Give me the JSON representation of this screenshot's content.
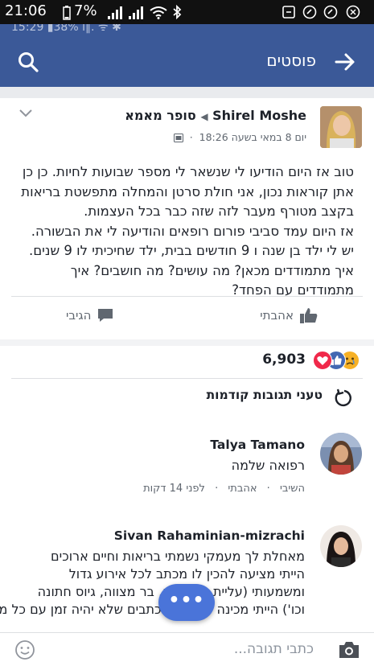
{
  "status_bar": {
    "time": "21:06",
    "battery": "7%",
    "icons": [
      "battery-icon",
      "signal-icon",
      "signal-icon",
      "wifi-icon",
      "bluetooth-icon",
      "notification-icon",
      "app-icon",
      "app-icon",
      "app-icon"
    ]
  },
  "ghost_status": {
    "text": "15:29 ▮38% ⅰ‖. ᯤ ✱"
  },
  "navbar": {
    "title": "פוסטים",
    "background": "#3b5998",
    "icons": [
      "back-arrow-icon",
      "search-icon"
    ]
  },
  "post": {
    "author": "Shirel Moshe",
    "separator": "◀",
    "group": "סופר מאמא",
    "timestamp": "יום 8 במאי בשעה 18:26",
    "body": [
      "טוב אז היום הודיעו לי שנשאר לי מספר שבועות לחיות. כן כן אתן קוראות נכון, אני חולת סרטן והמחלה מתפשטת בריאות בקצב מטורף מעבר לזה שזה כבר בכל העצמות.",
      "אז היום עמד סביבי פורום רופאים והודיעה לי את הבשורה.",
      "יש לי ילד בן שנה ו 9 חודשים בבית, ילד שחיכיתי לו 9 שנים. איך מתמודדים מכאן? מה עושים? מה חושבים? איך מתמודדים עם הפחד?"
    ],
    "like_label": "אהבתי",
    "comment_label": "הגיבי",
    "reactions_count": "6,903"
  },
  "prev_comments_label": "טעני תגובות קודמות",
  "comments": [
    {
      "name": "Talya Tamano",
      "text": "רפואה שלמה",
      "reply": "השיבי",
      "like": "אהבתי",
      "time": "לפני 14 דקות"
    },
    {
      "name": "Sivan Rahaminian-mizrachi",
      "lines": [
        "מאחלת לך מעמקי נשמתי בריאות וחיים ארוכים",
        "הייתי מציעה להכין לו מכתב לכל אירוע גדול",
        "ומשמעותי (עליית לכיתה א, בר מצווה, גיוס חתונה",
        "וכו') הייתי מכינה לו שלל מכתבים שלא יהיה זמן עם כל מיני דברים"
      ]
    }
  ],
  "bottom_bar": {
    "placeholder": "כתבי תגובה..."
  },
  "fab": {
    "label": "•••"
  }
}
